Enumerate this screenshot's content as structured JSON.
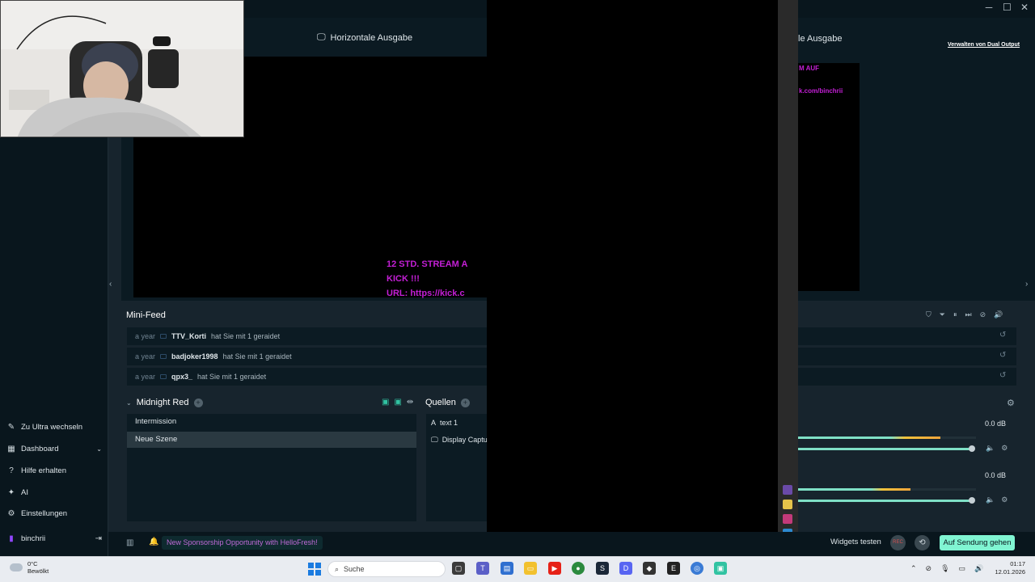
{
  "window": {
    "minimize": "─",
    "maximize": "☐",
    "close": "✕"
  },
  "editor": {
    "horizontal_label": "Horizontale Ausgabe",
    "vertical_label": "le Ausgabe",
    "dual_output_link": "Verwalten von Dual Output",
    "overlay_lines": "12 STD. STREAM A\nKICK !!!\nURL: https://kick.c",
    "right_overlay_1": "M AUF",
    "right_overlay_2": "k.com/binchrii"
  },
  "sidebar": {
    "items": [
      {
        "label": "Zu Ultra wechseln",
        "icon": "palette-icon"
      },
      {
        "label": "Dashboard",
        "icon": "dashboard-icon"
      },
      {
        "label": "Hilfe erhalten",
        "icon": "help-icon"
      },
      {
        "label": "AI",
        "icon": "sparkle-icon"
      },
      {
        "label": "Einstellungen",
        "icon": "gear-icon"
      }
    ],
    "user": "binchrii"
  },
  "minifeed": {
    "title": "Mini-Feed",
    "rows": [
      {
        "time": "a year",
        "user": "TTV_Korti",
        "action": "hat Sie mit 1 geraidet"
      },
      {
        "time": "a year",
        "user": "badjoker1998",
        "action": "hat Sie mit 1 geraidet"
      },
      {
        "time": "a year",
        "user": "qpx3_",
        "action": "hat Sie mit 1 geraidet"
      }
    ]
  },
  "scenes": {
    "collection": "Midnight Red",
    "items": [
      "Intermission",
      "Neue Szene"
    ],
    "active": "Neue Szene"
  },
  "sources": {
    "title": "Quellen",
    "items": [
      {
        "label": "text 1",
        "icon": "text-icon"
      },
      {
        "label": "Display Captu",
        "icon": "monitor-icon"
      }
    ]
  },
  "mixer": {
    "channels": [
      {
        "db": "0.0 dB",
        "level": 0.8
      },
      {
        "db": "0.0 dB",
        "level": 0.63
      }
    ]
  },
  "footer": {
    "sponsor": "New Sponsorship Opportunity with HelloFresh!",
    "widgets_test": "Widgets testen",
    "rec": "REC",
    "go_live": "Auf Sendung gehen"
  },
  "taskbar": {
    "weather_temp": "0°C",
    "weather_desc": "Bewölkt",
    "search_placeholder": "Suche",
    "time": "01:17",
    "date": "12.01.2026"
  },
  "colors": {
    "accent": "#80f5d2",
    "overlay_purple": "#c41fd6",
    "panel": "#0c1b23",
    "background": "#17242d"
  }
}
